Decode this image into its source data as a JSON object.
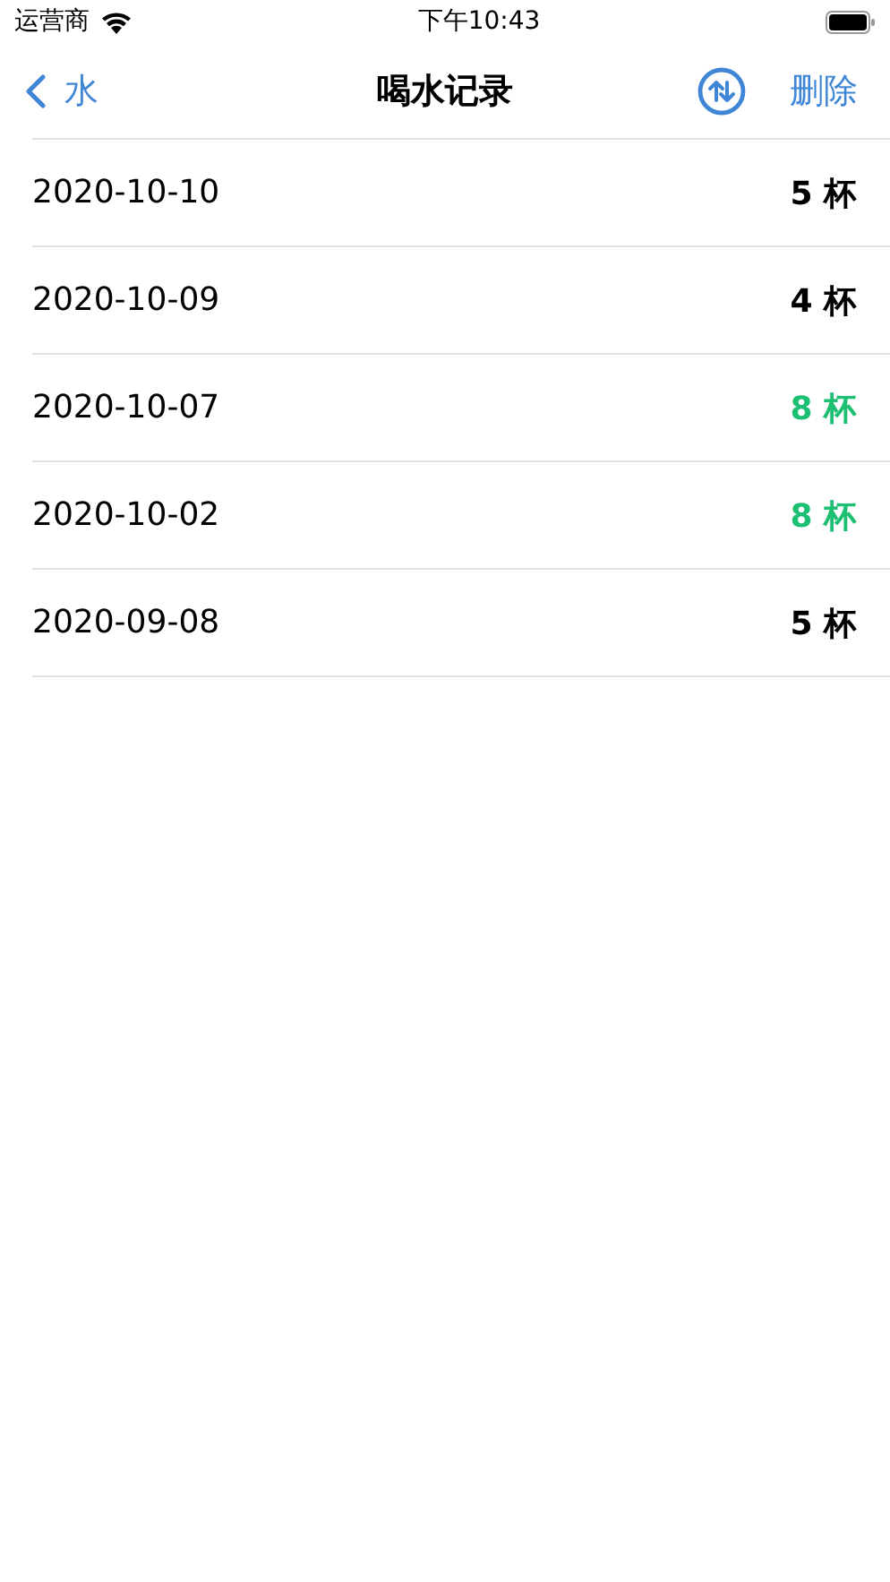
{
  "status_bar": {
    "carrier": "运营商",
    "time": "下午10:43"
  },
  "nav_bar": {
    "back_label": "水",
    "title": "喝水记录",
    "action": "删除"
  },
  "records": [
    {
      "date": "2020-10-10",
      "count": "5 杯",
      "color": "#000000"
    },
    {
      "date": "2020-10-09",
      "count": "4 杯",
      "color": "#000000"
    },
    {
      "date": "2020-10-07",
      "count": "8 杯",
      "color": "#1dbf73"
    },
    {
      "date": "2020-10-02",
      "count": "8 杯",
      "color": "#1dbf73"
    },
    {
      "date": "2020-09-08",
      "count": "5 杯",
      "color": "#000000"
    }
  ]
}
